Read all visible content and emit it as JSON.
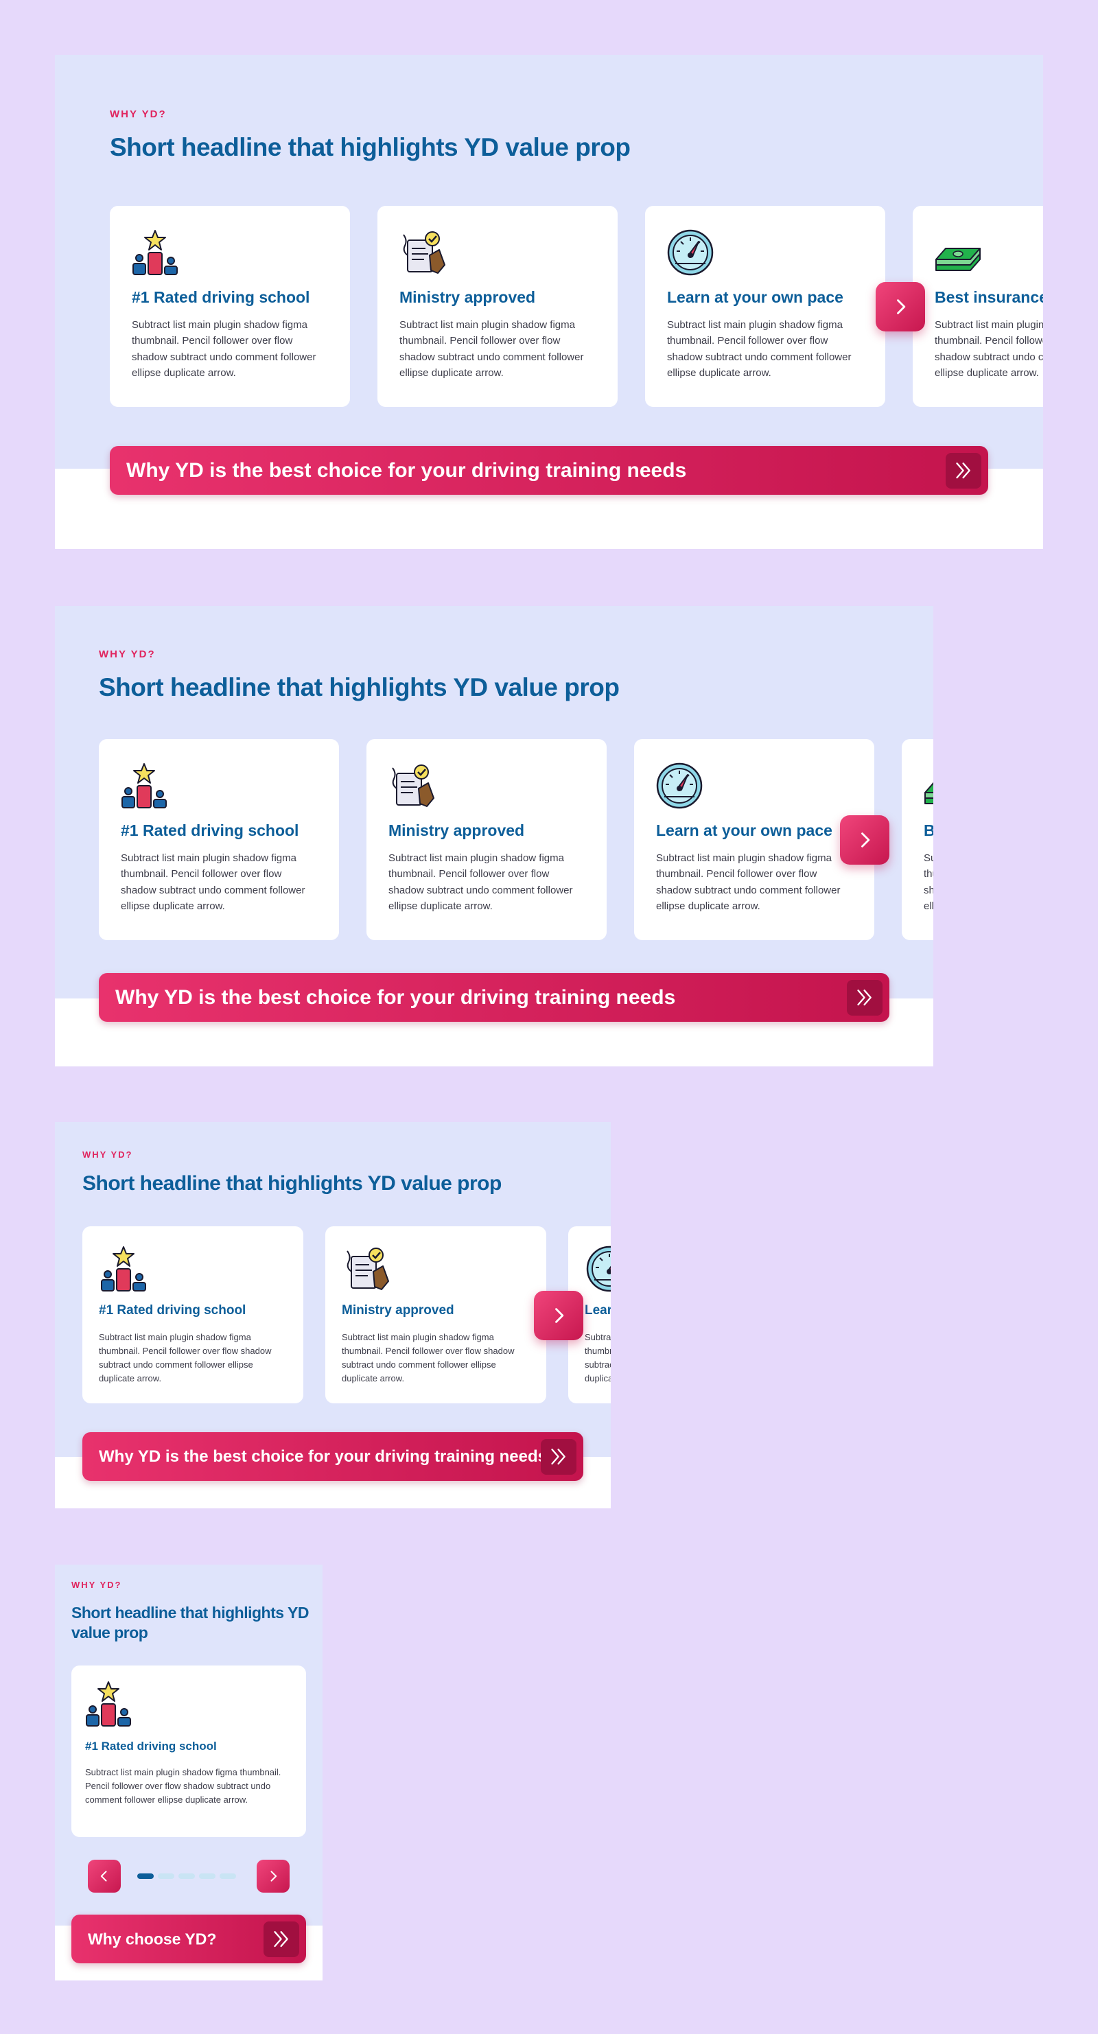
{
  "eyebrow": "WHY YD?",
  "headline": "Short headline that highlights YD value prop",
  "cards": [
    {
      "title": "#1 Rated driving school",
      "body": "Subtract list main plugin shadow figma thumbnail. Pencil follower over flow shadow subtract undo comment follower ellipse duplicate arrow.",
      "icon": "podium-star-icon"
    },
    {
      "title": "Ministry approved",
      "body": "Subtract list main plugin shadow figma thumbnail. Pencil follower over flow shadow subtract undo comment follower ellipse duplicate arrow.",
      "icon": "approved-document-icon"
    },
    {
      "title": "Learn at your own pace",
      "body": "Subtract list main plugin shadow figma thumbnail. Pencil follower over flow shadow subtract undo comment follower ellipse duplicate arrow.",
      "icon": "speedometer-icon"
    },
    {
      "title": "Best insurance",
      "body": "Subtract list main plugin shadow figma thumbnail. Pencil follower over flow shadow subtract undo comment follower ellipse duplicate arrow.",
      "icon": "money-stack-icon"
    }
  ],
  "cta_long": "Why YD is the best choice for your driving training needs",
  "cta_short": "Why choose YD?",
  "icons": {
    "next": "chevron-right-icon",
    "prev": "chevron-left-icon",
    "cta": "double-chevron-right-icon"
  },
  "colors": {
    "background": "#e6d9fb",
    "band": "#dfe4fb",
    "accent": "#e0245e",
    "heading": "#0d5e99",
    "cta": "#d41f5c"
  },
  "carousel": {
    "total_dots": 5,
    "active_dot": 1
  }
}
